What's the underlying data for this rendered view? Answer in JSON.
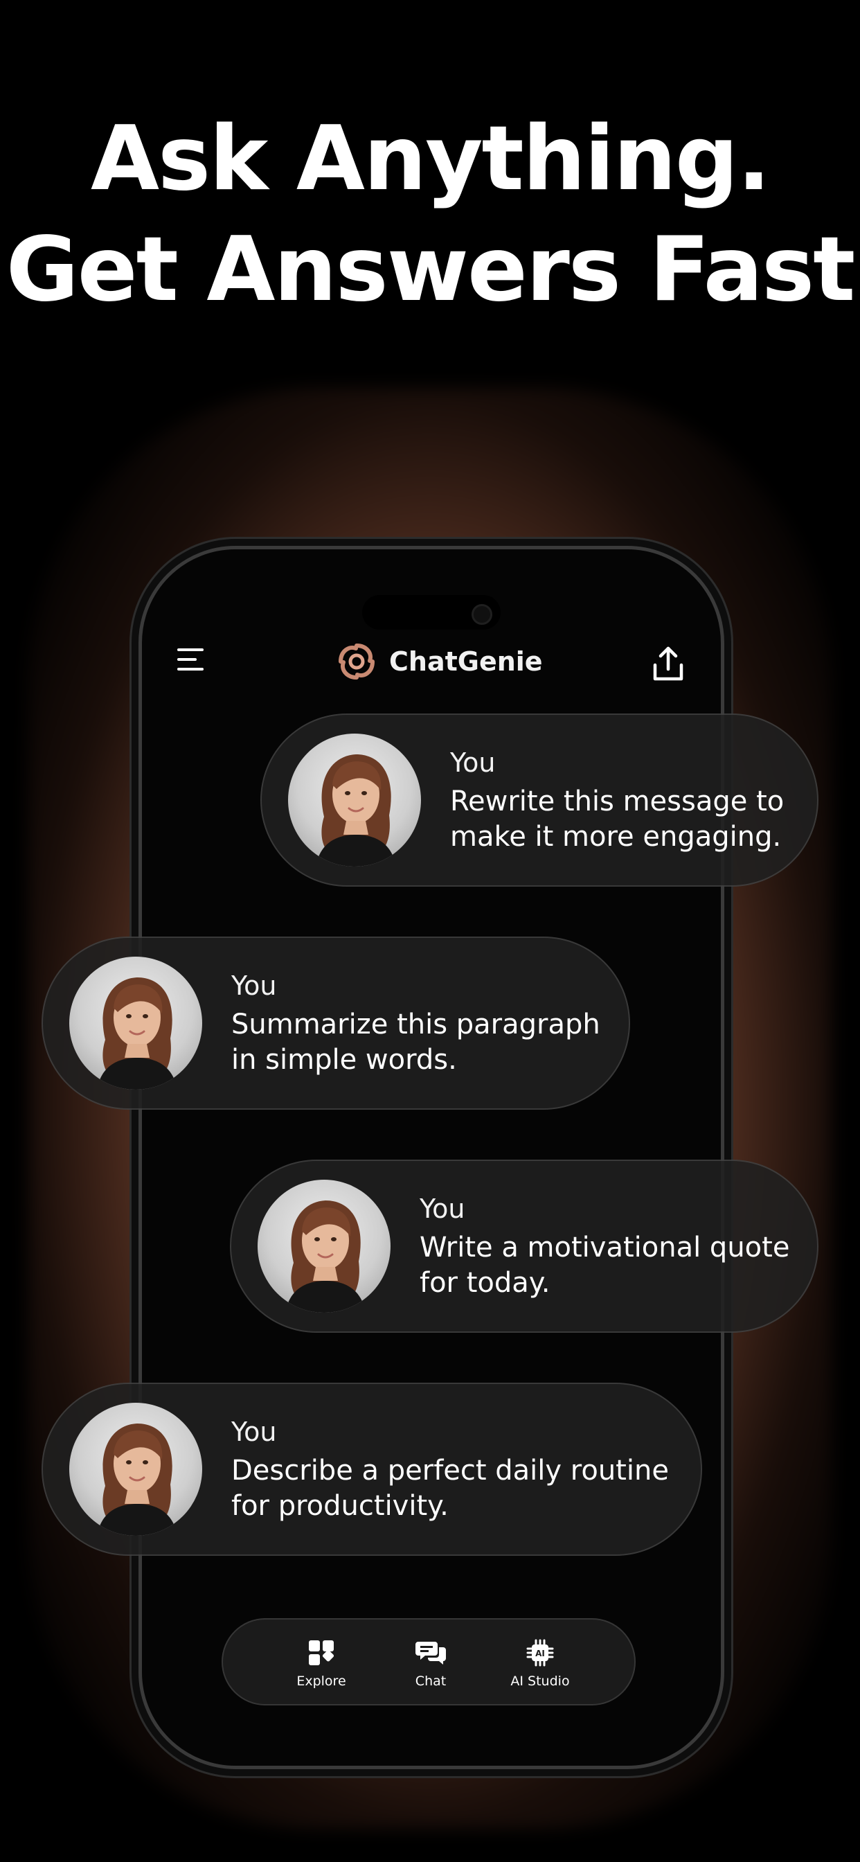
{
  "headline": {
    "line1": "Ask Anything.",
    "line2": "Get Answers Fast"
  },
  "app": {
    "name": "ChatGenie",
    "accent_color": "#c98a72",
    "glow_color": "#a9694e",
    "menu_icon": "hamburger-menu-icon",
    "share_icon": "share-upload-icon"
  },
  "messages": [
    {
      "author": "You",
      "line1": "Rewrite this message to",
      "line2": "make it more engaging."
    },
    {
      "author": "You",
      "line1": "Summarize this paragraph",
      "line2": "in simple words."
    },
    {
      "author": "You",
      "line1": "Write a motivational quote",
      "line2": "for today."
    },
    {
      "author": "You",
      "line1": "Describe a perfect daily routine",
      "line2": "for productivity."
    }
  ],
  "tabbar": {
    "items": [
      {
        "label": "Explore",
        "icon": "grid-icon"
      },
      {
        "label": "Chat",
        "icon": "chat-bubbles-icon"
      },
      {
        "label": "AI Studio",
        "icon": "ai-chip-icon",
        "icon_text": "AI"
      }
    ]
  }
}
